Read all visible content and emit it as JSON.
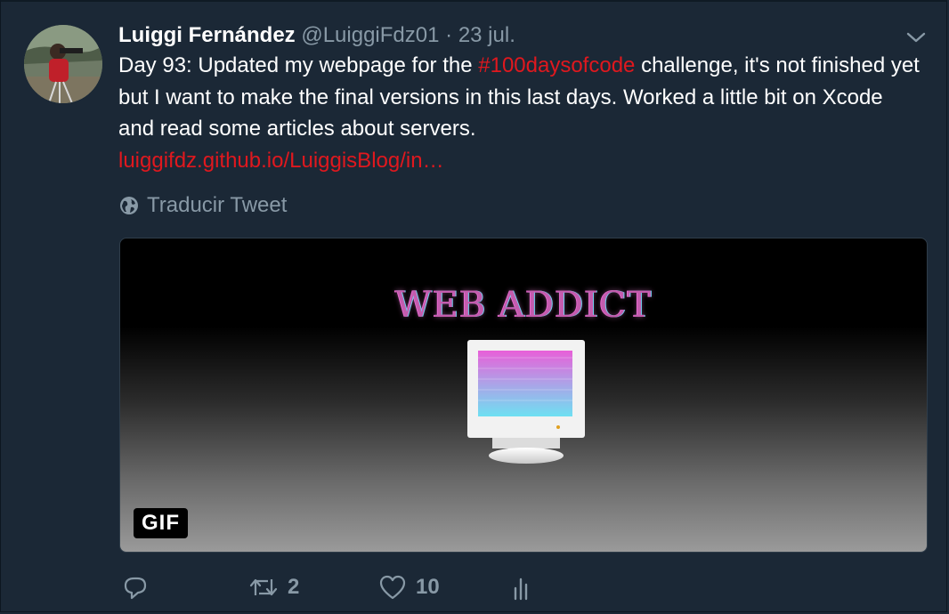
{
  "tweet": {
    "author_name": "Luiggi Fernández",
    "handle": "@LuiggiFdz01",
    "separator": "·",
    "date": "23 jul.",
    "text_before": "Day 93: Updated my webpage for the ",
    "hashtag": "#100daysofcode",
    "text_after": " challenge, it's not finished yet but I want to make the final versions in this last days. Worked a little bit on Xcode and read some articles about servers.",
    "link": "luiggifdz.github.io/LuiggisBlog/in…",
    "translate_label": "Traducir Tweet"
  },
  "media": {
    "gif_text": "WEB ADDICT",
    "badge": "GIF"
  },
  "actions": {
    "reply_count": "",
    "retweet_count": "2",
    "like_count": "10"
  },
  "icons": {
    "caret": "chevron-down-icon",
    "translate": "globe-icon",
    "reply": "reply-icon",
    "retweet": "retweet-icon",
    "like": "heart-icon",
    "analytics": "analytics-icon"
  },
  "colors": {
    "background": "#1b2836",
    "accent": "#e0181e",
    "muted": "#8899a6",
    "text": "#ffffff"
  }
}
